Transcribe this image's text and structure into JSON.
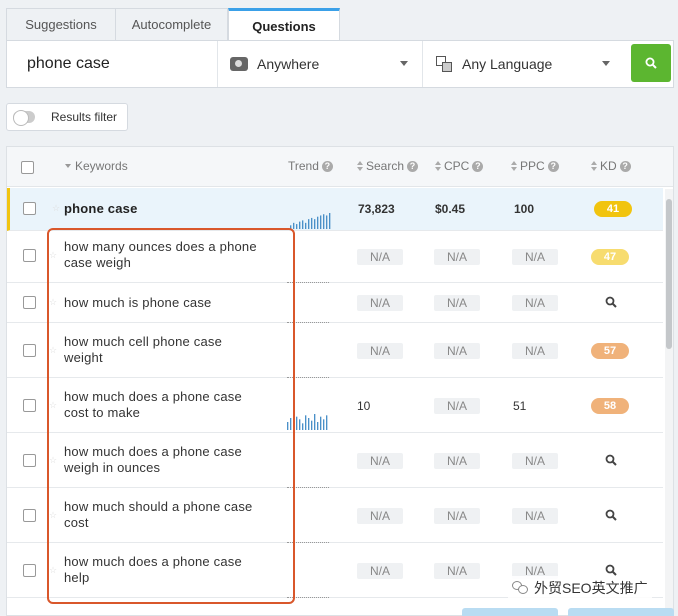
{
  "tabs": [
    "Suggestions",
    "Autocomplete",
    "Questions"
  ],
  "search": {
    "query": "phone case",
    "location": "Anywhere",
    "language": "Any Language"
  },
  "filter": {
    "label": "Results filter"
  },
  "columns": {
    "keywords": "Keywords",
    "trend": "Trend",
    "search": "Search",
    "cpc": "CPC",
    "ppc": "PPC",
    "kd": "KD"
  },
  "rows": [
    {
      "keyword": "phone case",
      "search": "73,823",
      "cpc": "$0.45",
      "ppc": "100",
      "kd": "41",
      "kd_color": "#f1c40f",
      "trend": [
        3,
        5,
        4,
        6,
        7,
        5,
        8,
        9,
        8,
        10,
        11,
        12,
        11,
        13
      ]
    },
    {
      "keyword": "how many ounces does a phone case weigh",
      "search": "N/A",
      "cpc": "N/A",
      "ppc": "N/A",
      "kd": "47",
      "kd_color": "#f7dc6f"
    },
    {
      "keyword": "how much is phone case",
      "search": "N/A",
      "cpc": "N/A",
      "ppc": "N/A",
      "kd": ""
    },
    {
      "keyword": "how much cell phone case weight",
      "search": "N/A",
      "cpc": "N/A",
      "ppc": "N/A",
      "kd": "57",
      "kd_color": "#f0b27a"
    },
    {
      "keyword": "how much does a phone case cost to make",
      "search": "10",
      "cpc": "N/A",
      "ppc": "51",
      "kd": "58",
      "kd_color": "#f0b27a",
      "trend": [
        6,
        9,
        4,
        10,
        8,
        5,
        11,
        9,
        7,
        12,
        6,
        10,
        8,
        11
      ]
    },
    {
      "keyword": "how much does a phone case weigh in ounces",
      "search": "N/A",
      "cpc": "N/A",
      "ppc": "N/A",
      "kd": ""
    },
    {
      "keyword": "how much should a phone case cost",
      "search": "N/A",
      "cpc": "N/A",
      "ppc": "N/A",
      "kd": ""
    },
    {
      "keyword": "how much does a phone case help",
      "search": "N/A",
      "cpc": "N/A",
      "ppc": "N/A",
      "kd": ""
    }
  ],
  "watermark": "外贸SEO英文推广",
  "colors": {
    "accent": "#3aa0e8",
    "go_button": "#5cb630",
    "highlight": "#d9572b"
  },
  "icons": {
    "go": "search-icon",
    "location": "globe-icon",
    "language": "language-icon"
  }
}
